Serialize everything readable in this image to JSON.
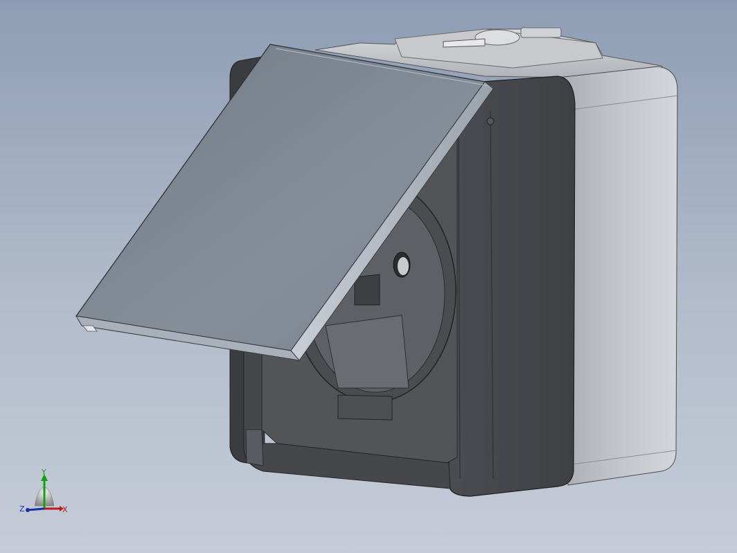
{
  "viewport": {
    "background_top": "#8e9db5",
    "background_bottom": "#c6ccd8"
  },
  "model": {
    "housing_color": "#3d3f43",
    "side_color": "#b9bcc1",
    "lid_color": "#7d8690",
    "face_color": "#525458"
  },
  "triad": {
    "x_label": "X",
    "y_label": "Y",
    "z_label": "Z",
    "x_color": "#c01818",
    "y_color": "#16a016",
    "z_color": "#1a2ea8"
  }
}
